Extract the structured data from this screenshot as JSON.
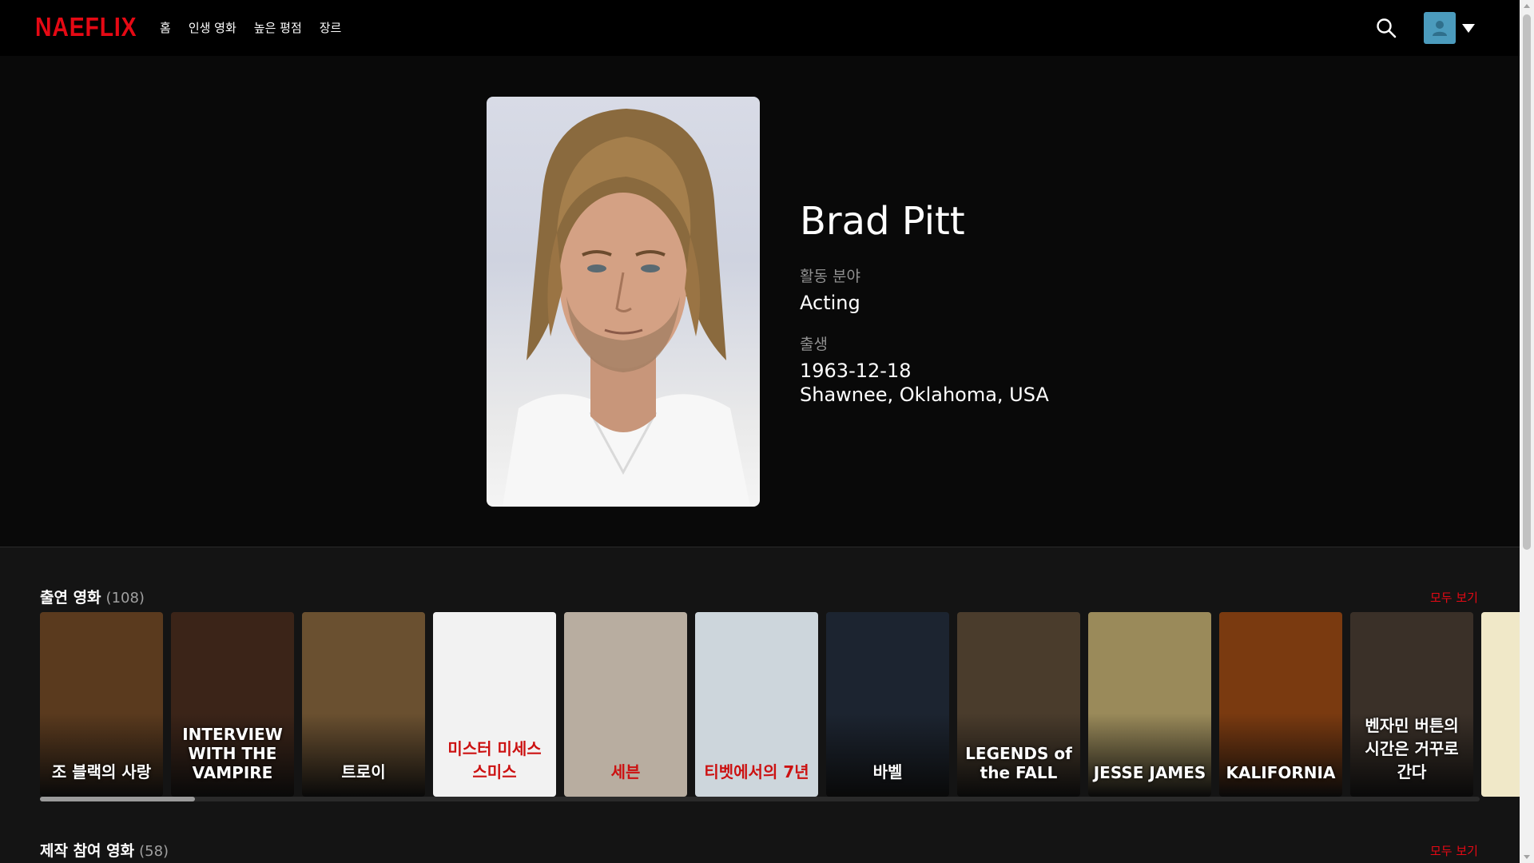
{
  "nav": {
    "logo": "NAEFLIX",
    "links": [
      "홈",
      "인생 영화",
      "높은 평점",
      "장르"
    ],
    "search_icon": "search-icon",
    "avatar_icon": "user-icon",
    "avatar_color": "#4b9bbd"
  },
  "person": {
    "name": "Brad Pitt",
    "dept_label": "활동 분야",
    "dept_value": "Acting",
    "birth_label": "출생",
    "birth_date": "1963-12-18",
    "birth_place": "Shawnee, Oklahoma, USA"
  },
  "rows": [
    {
      "title": "출연 영화",
      "count": "(108)",
      "see_all": "모두 보기"
    },
    {
      "title": "제작 참여 영화",
      "count": "(58)",
      "see_all": "모두 보기"
    }
  ],
  "posters": [
    {
      "title": "조 블랙의 사랑",
      "bg": "#5a3a1e"
    },
    {
      "title": "INTERVIEW WITH THE VAMPIRE",
      "bg": "#3b2418"
    },
    {
      "title": "트로이",
      "bg": "#6a5030"
    },
    {
      "title": "미스터 미세스 스미스",
      "bg": "#f2f2f2"
    },
    {
      "title": "세븐",
      "bg": "#b8ada0"
    },
    {
      "title": "티벳에서의 7년",
      "bg": "#cdd6dc"
    },
    {
      "title": "바벨",
      "bg": "#1c2430"
    },
    {
      "title": "LEGENDS of the FALL",
      "bg": "#4a3c2c"
    },
    {
      "title": "JESSE JAMES",
      "bg": "#9a8a5a"
    },
    {
      "title": "KALIFORNIA",
      "bg": "#7a3a10"
    },
    {
      "title": "벤자민 버튼의 시간은 거꾸로 간다",
      "bg": "#3a3028"
    },
    {
      "title": "",
      "bg": "#f0e8c8"
    }
  ],
  "colors": {
    "accent": "#e50914",
    "background": "#141414",
    "hero": "#090909"
  }
}
